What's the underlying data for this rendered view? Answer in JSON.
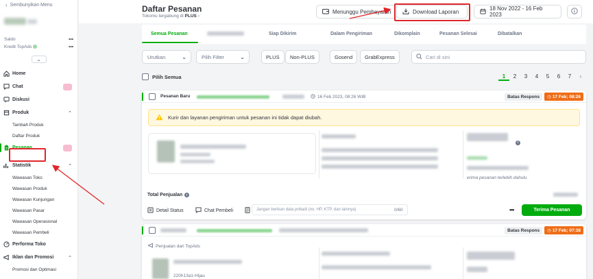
{
  "sidebar": {
    "hide_menu": "Sembunyikan Menu",
    "saldo": "Saldo",
    "kredit_topads": "Kredit TopAds",
    "more_dots": "•••",
    "nav": {
      "home": "Home",
      "chat": "Chat",
      "diskusi": "Diskusi",
      "produk": "Produk",
      "tambah_produk": "Tambah Produk",
      "daftar_produk": "Daftar Produk",
      "pesanan": "Pesanan",
      "statistik": "Statistik",
      "wawasan_toko": "Wawasan Toko",
      "wawasan_produk": "Wawasan Produk",
      "wawasan_kunjungan": "Wawasan Kunjungan",
      "wawasan_pasar": "Wawasan Pasar",
      "wawasan_operasional": "Wawasan Operasional",
      "wawasan_pembeli": "Wawasan Pembeli",
      "performa_toko": "Performa Toko",
      "iklan_promosi": "Iklan dan Promosi",
      "promosi_optimasi": "Promosi dan Optimasi"
    }
  },
  "header": {
    "title": "Daftar Pesanan",
    "subtitle_prefix": "Tokomu tergabung di",
    "subtitle_program": "PLUS",
    "menunggu_pembayaran": "Menunggu Pembayaran",
    "download_laporan": "Download Laporan",
    "date_range": "18 Nov 2022 - 16 Feb 2023"
  },
  "tabs": [
    "Semua Pesanan",
    "Siap Dikirim",
    "Dalam Pengiriman",
    "Dikomplain",
    "Pesanan Selesai",
    "Dibatalkan"
  ],
  "filters": {
    "urutkan": "Urutkan",
    "pilih_filter": "Pilih Filter",
    "chips": [
      "PLUS",
      "Non-PLUS",
      "Gosend",
      "GrabExpress"
    ],
    "search_placeholder": "Cari di sini"
  },
  "list": {
    "pilih_semua": "Pilih Semua",
    "pages": [
      "1",
      "2",
      "3",
      "4",
      "5",
      "6",
      "7"
    ],
    "current_page": "1"
  },
  "orders": [
    {
      "status": "Pesanan Baru",
      "date": "16 Feb 2023, 08:26 WIB",
      "batas_label": "Batas Respons",
      "batas_time": "17 Feb; 08:26",
      "warning": "Kurir dan layanan pengiriman untuk pesanan ini tidak dapat diubah.",
      "note_italic": "erima pesanan terlebih dahulu",
      "total_label": "Total Penjualan",
      "detail_status": "Detail Status",
      "chat_pembeli": "Chat Pembeli",
      "note_placeholder": "Jangan berikan data pribadi (no. HP, KTP, dan lainnya)",
      "note_count": "0/60",
      "more": "•••",
      "terima": "Terima Pesanan"
    },
    {
      "batas_label": "Batas Respons",
      "batas_time": "17 Feb; 07:38",
      "ads_label": "Penjualan dari TopAds",
      "variant": "220h13a1-Hijau"
    }
  ]
}
